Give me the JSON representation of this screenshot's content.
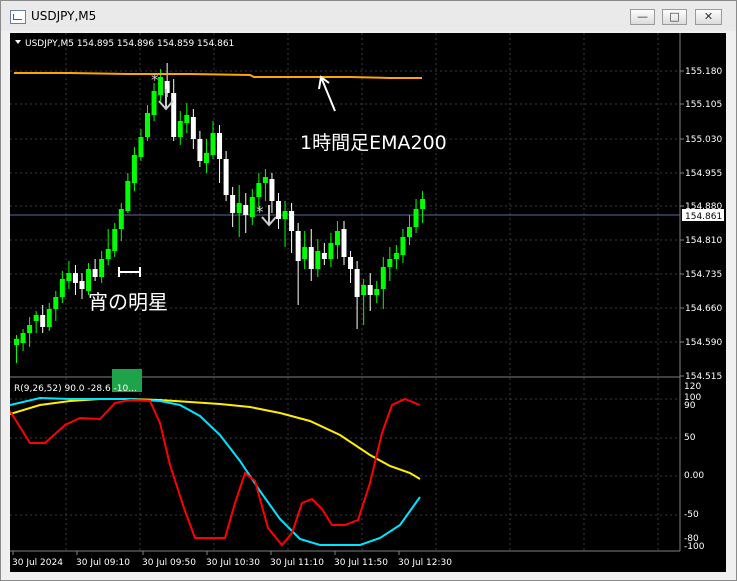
{
  "window": {
    "title": "USDJPY,M5",
    "buttons": {
      "minimize": "—",
      "maximize": "□",
      "close": "✕"
    }
  },
  "main_chart": {
    "info_line": "USDJPY,M5  154.895 154.896 154.859 154.861",
    "price_labels": [
      "155.180",
      "155.105",
      "155.030",
      "154.955",
      "154.880",
      "154.810",
      "154.735",
      "154.660",
      "154.590",
      "154.515"
    ],
    "current_price": "154.861",
    "annotations": {
      "ema_label": "1時間足EMA200",
      "evening_star_label": "宵の明星"
    },
    "colors": {
      "bull": "#00ff00",
      "bear": "#ffffff",
      "ema": "#ffa500",
      "grid": "#404040",
      "highlight": "#1fa34a"
    }
  },
  "indicator": {
    "info_line": "R(9,26,52) 90.0 -28.6 -10...",
    "scale_labels": [
      "120",
      "100",
      "90",
      "50",
      "0.00",
      "-50",
      "-80",
      "-100"
    ],
    "colors": {
      "fast": "#ff0000",
      "mid": "#00e5ff",
      "slow": "#ffee00"
    }
  },
  "time_axis": {
    "labels": [
      "30 Jul 2024",
      "30 Jul 09:10",
      "30 Jul 09:50",
      "30 Jul 10:30",
      "30 Jul 11:10",
      "30 Jul 11:50",
      "30 Jul 12:30"
    ]
  }
}
